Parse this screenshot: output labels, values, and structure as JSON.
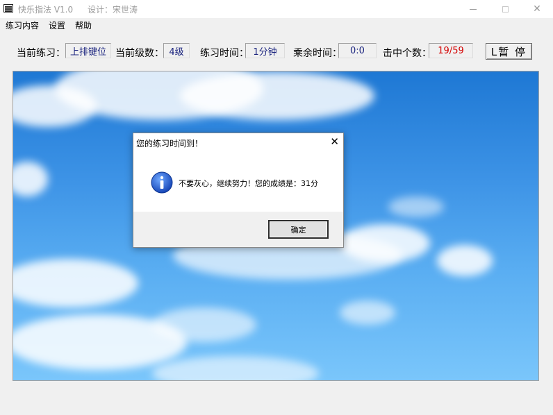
{
  "window": {
    "title": "快乐指法 V1.0",
    "designer": "设计：宋世涛",
    "icons": {
      "app": "keyboard-icon",
      "minimize": "minimize-icon",
      "maximize": "maximize-icon",
      "close": "close-icon"
    }
  },
  "menu": {
    "items": [
      "练习内容",
      "设置",
      "帮助"
    ]
  },
  "status": {
    "current_practice_label": "当前练习：",
    "current_practice_value": "上排键位",
    "current_level_label": "当前级数：",
    "current_level_value": "4级",
    "practice_time_label": "练习时间：",
    "practice_time_value": "1分钟",
    "remaining_time_label": "乘余时间：",
    "remaining_time_value": "0:0",
    "hits_label": "击中个数：",
    "hits_value": "19/59",
    "hits_color": "#d40000",
    "pause_label": "L暂  停"
  },
  "dialog": {
    "title": "您的练习时间到！",
    "close_glyph": "✕",
    "icon": "info-icon",
    "message": "不要灰心，继续努力！您的成绩是：31分",
    "ok_label": "确定"
  }
}
